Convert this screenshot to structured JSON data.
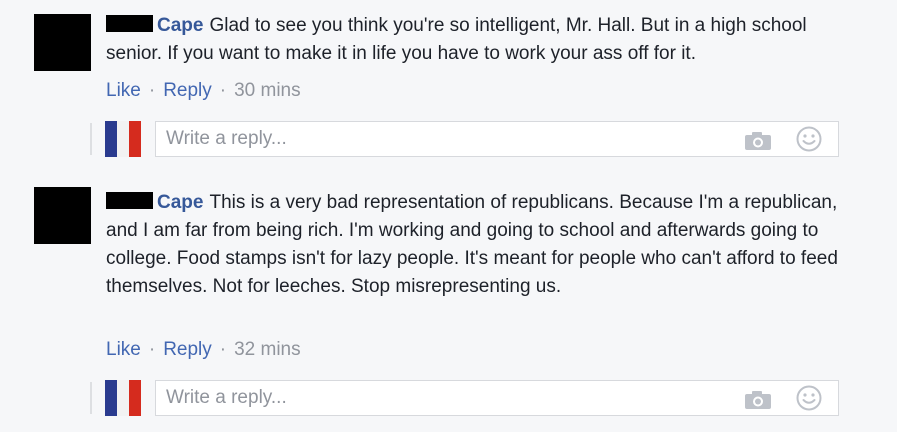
{
  "comments": [
    {
      "author": "Cape",
      "text": "Glad to see you think you're so intelligent, Mr. Hall. But in a high school senior. If you want to make it in life you have to work your ass off for it.",
      "like_label": "Like",
      "reply_label": "Reply",
      "time": "30 mins",
      "reply_placeholder": "Write a reply..."
    },
    {
      "author": "Cape",
      "text": "This is a very bad representation of republicans. Because I'm a republican, and I am far from being rich. I'm working and going to school and afterwards going to college. Food stamps isn't for lazy people. It's meant for people who can't afford to feed themselves. Not for leeches. Stop misrepresenting us.",
      "like_label": "Like",
      "reply_label": "Reply",
      "time": "32 mins",
      "reply_placeholder": "Write a reply..."
    }
  ],
  "icons": {
    "camera": "camera-icon",
    "emoji": "smiley-icon"
  },
  "colors": {
    "link": "#4267b2",
    "author": "#365899",
    "meta": "#90949c",
    "background": "#f6f7f9"
  }
}
